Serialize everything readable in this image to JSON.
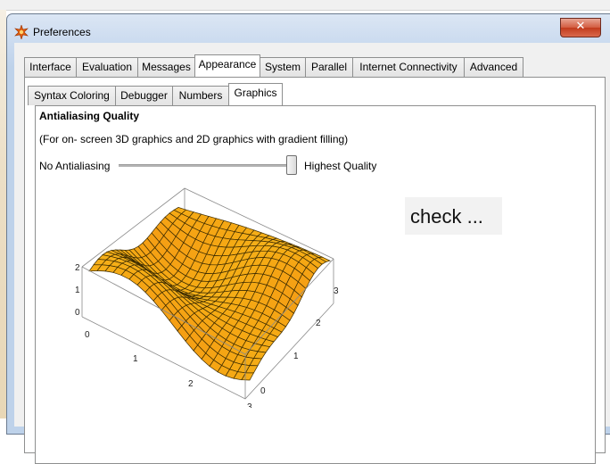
{
  "window": {
    "title": "Preferences",
    "close_glyph": "✕"
  },
  "main_tabs": [
    "Interface",
    "Evaluation",
    "Messages",
    "Appearance",
    "System",
    "Parallel",
    "Internet Connectivity",
    "Advanced"
  ],
  "main_tab_active": "Appearance",
  "sub_tabs": [
    "Syntax Coloring",
    "Debugger",
    "Numbers",
    "Graphics"
  ],
  "sub_tab_active": "Graphics",
  "antialiasing": {
    "title": "Antialiasing Quality",
    "description": "(For on- screen 3D graphics and 2D graphics with gradient filling)",
    "slider_min_label": "No Antialiasing",
    "slider_max_label": "Highest Quality",
    "slider_level": 1.0
  },
  "plot": {
    "z_ticks": [
      "2",
      "1",
      "0"
    ],
    "x_ticks": [
      "0",
      "1",
      "2",
      "3"
    ],
    "y_ticks": [
      "0",
      "1",
      "2",
      "3"
    ],
    "surface_color": "#f5a800"
  },
  "overlay": {
    "text": "check ..."
  },
  "icons": {
    "app_icon": "mathematica-star-icon",
    "close": "close-icon"
  }
}
